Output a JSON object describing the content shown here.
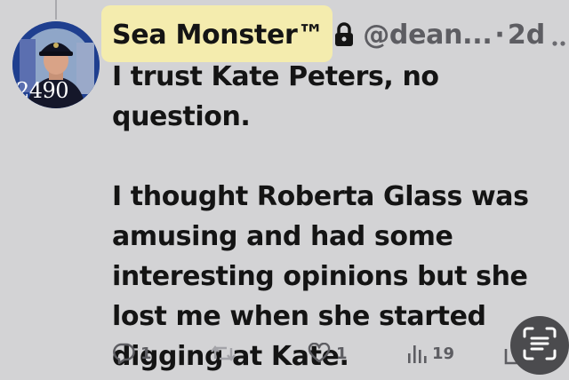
{
  "post": {
    "author": {
      "display_name": "Sea Monster™",
      "handle": "@dean...",
      "separator": "·",
      "time_ago": "2d",
      "avatar_badge_text": "2490"
    },
    "body": {
      "paragraph_1": "I trust Kate Peters, no question.",
      "paragraph_2": "I thought Roberta Glass was amusing and had some interesting opinions but she lost me when she started digging at Kate."
    },
    "actions": {
      "reply_count": "1",
      "retweet_count": "",
      "like_count": "1",
      "views_count": "19"
    }
  },
  "colors": {
    "background": "#d3d3d5",
    "name_highlight": "#f4ecae",
    "text_primary": "#141414",
    "text_secondary": "#5d5d62",
    "avatar_ring": "#1f3f8f",
    "scan_button": "#4b4b4e"
  },
  "icons": {
    "lock": "lock-icon",
    "more": "more-options-icon",
    "reply": "reply-icon",
    "retweet": "retweet-icon",
    "like": "heart-icon",
    "views": "views-bar-chart-icon",
    "share": "share-icon",
    "scan": "scan-text-icon"
  }
}
